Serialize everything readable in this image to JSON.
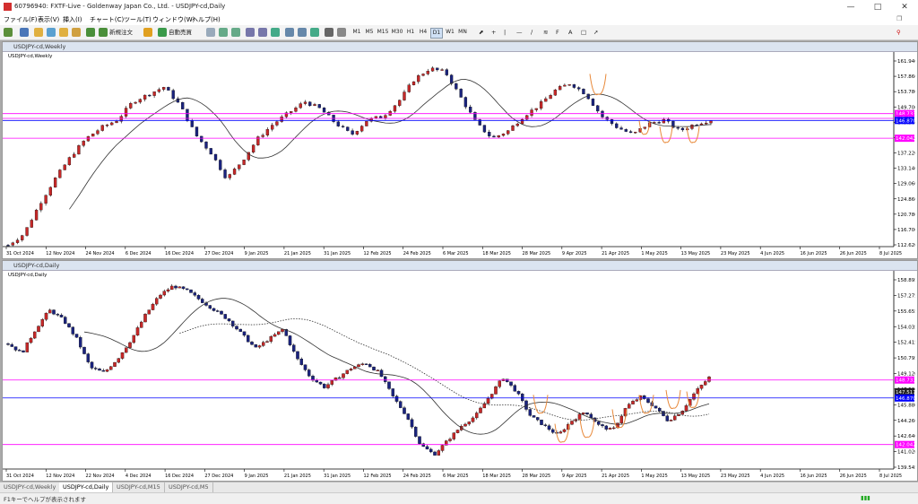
{
  "window": {
    "title": "60796940: FXTF-Live - Goldenway Japan Co., Ltd. - USDJPY-cd,Daily"
  },
  "menu": [
    "ファイル(F)",
    "表示(V)",
    "挿入(I)",
    "チャート(C)",
    "ツール(T)",
    "ウィンドウ(W)",
    "ヘルプ(H)"
  ],
  "toolbar": {
    "new_order": "新規注文",
    "auto_trading": "自動売買",
    "timeframes": [
      "M1",
      "M5",
      "M15",
      "M30",
      "H1",
      "H4",
      "D1",
      "W1",
      "MN"
    ],
    "active_timeframe": "D1"
  },
  "colors": {
    "bull": "#c62828",
    "bear": "#1a237e",
    "ma": "#333333",
    "hline": "#ff00ff",
    "blueline": "#0000ff",
    "annot": "#e8893a"
  },
  "weekly": {
    "title": "USDJPY-cd,Weekly",
    "label": "USDJPY-cd,Weekly",
    "price_axis": [
      "161.940",
      "157.860",
      "153.780",
      "149.700",
      "145.500",
      "141.420",
      "137.220",
      "133.140",
      "129.060",
      "124.860",
      "120.780",
      "116.700",
      "112.620"
    ],
    "time_axis": [
      "31 Oct 2024",
      "12 Nov 2024",
      "24 Nov 2024",
      "6 Dec 2024",
      "16 Dec 2024",
      "27 Dec 2024",
      "9 Jan 2025",
      "21 Jan 2025",
      "31 Jan 2025",
      "12 Feb 2025",
      "24 Feb 2025",
      "6 Mar 2025",
      "18 Mar 2025",
      "28 Mar 2025",
      "9 Apr 2025",
      "21 Apr 2025",
      "1 May 2025",
      "13 May 2025",
      "23 May 2025",
      "4 Jun 2025",
      "16 Jun 2025",
      "26 Jun 2025",
      "8 Jul 2025"
    ],
    "price_tags": [
      {
        "value": "148.733",
        "color": "#ff00ff"
      },
      {
        "value": "147.427",
        "color": "#ff00ff"
      },
      {
        "value": "146.870",
        "color": "#0000ff"
      },
      {
        "value": "142.042",
        "color": "#ff00ff"
      }
    ]
  },
  "daily": {
    "title": "USDJPY-cd,Daily",
    "label": "USDJPY-cd,Daily",
    "price_axis": [
      "158.895",
      "157.275",
      "155.655",
      "154.035",
      "152.415",
      "150.795",
      "149.120",
      "147.500",
      "145.880",
      "144.260",
      "142.640",
      "141.020",
      "139.545"
    ],
    "time_axis": [
      "31 Oct 2024",
      "12 Nov 2024",
      "22 Nov 2024",
      "4 Dec 2024",
      "16 Dec 2024",
      "27 Dec 2024",
      "9 Jan 2025",
      "21 Jan 2025",
      "31 Jan 2025",
      "12 Feb 2025",
      "24 Feb 2025",
      "6 Mar 2025",
      "18 Mar 2025",
      "28 Mar 2025",
      "9 Apr 2025",
      "21 Apr 2025",
      "1 May 2025",
      "13 May 2025",
      "23 May 2025",
      "4 Jun 2025",
      "16 Jun 2025",
      "26 Jun 2025",
      "8 Jul 2025"
    ],
    "price_tags": [
      {
        "value": "148.733",
        "color": "#ff00ff"
      },
      {
        "value": "147.517",
        "color": "#222222"
      },
      {
        "value": "146.870",
        "color": "#0000ff"
      },
      {
        "value": "142.042",
        "color": "#ff00ff"
      }
    ]
  },
  "tabs": [
    "USDJPY-cd,Weekly",
    "USDJPY-cd,Daily",
    "USDJPY-cd,M15",
    "USDJPY-cd,M5"
  ],
  "active_tab": "USDJPY-cd,Daily",
  "status": {
    "help": "F1キーでヘルプが表示されます"
  }
}
